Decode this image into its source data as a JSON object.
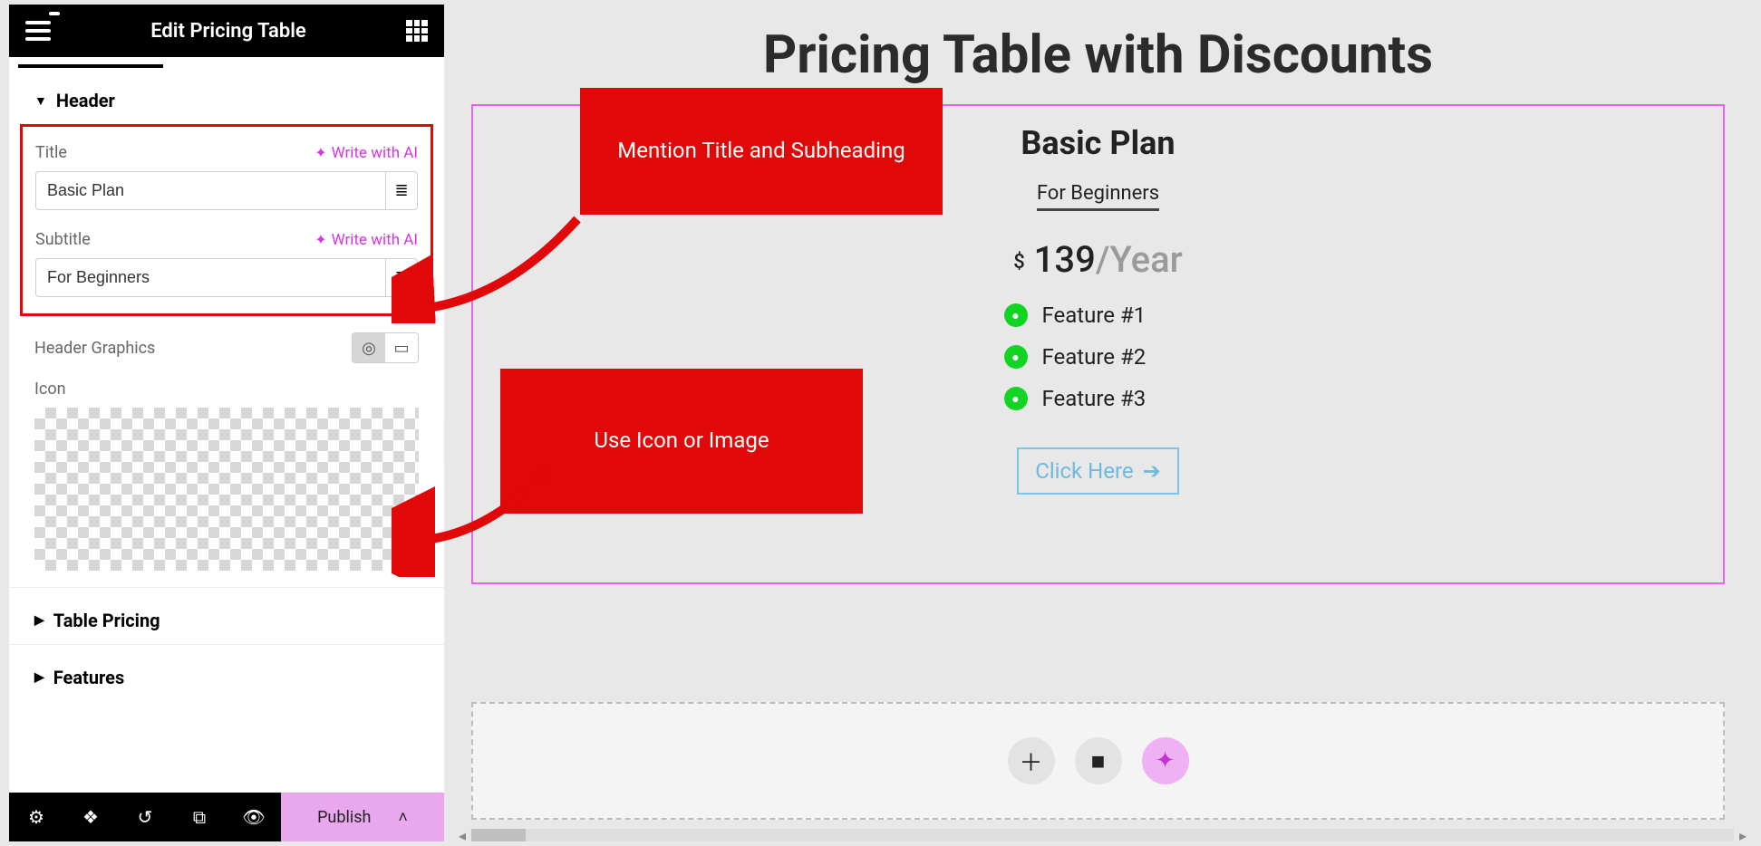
{
  "topbar": {
    "title": "Edit Pricing Table"
  },
  "sections": {
    "header": {
      "label": "Header",
      "title_label": "Title",
      "title_value": "Basic Plan",
      "subtitle_label": "Subtitle",
      "subtitle_value": "For Beginners",
      "ai_label": "Write with AI",
      "graphics_label": "Header Graphics",
      "icon_label": "Icon"
    },
    "table_pricing": {
      "label": "Table Pricing"
    },
    "features": {
      "label": "Features"
    }
  },
  "bottombar": {
    "publish": "Publish"
  },
  "canvas": {
    "title": "Pricing Table with Discounts",
    "card": {
      "title": "Basic Plan",
      "subtitle": "For Beginners",
      "currency": "$",
      "price": "139",
      "sep": "/",
      "period": "Year",
      "features": [
        "Feature #1",
        "Feature #2",
        "Feature #3"
      ],
      "cta": "Click Here"
    }
  },
  "callouts": {
    "c1": "Mention Title and Subheading",
    "c2": "Use Icon or Image"
  }
}
